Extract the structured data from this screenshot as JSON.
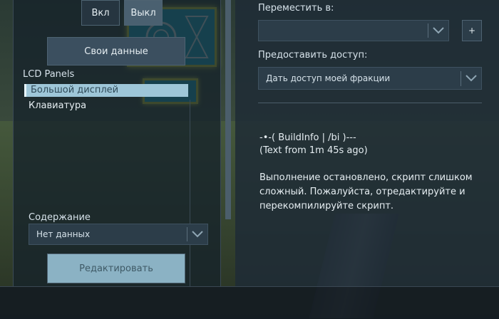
{
  "toggle": {
    "on_label": "Вкл",
    "off_label": "Выкл"
  },
  "custom_data_label": "Свои данные",
  "lcd": {
    "header": "LCD Panels",
    "items": [
      "Большой дисплей",
      "Клавиатура"
    ],
    "selected_index": 0
  },
  "content": {
    "label": "Содержание",
    "selected": "Нет данных"
  },
  "edit_label": "Редактировать",
  "move": {
    "label": "Переместить в:",
    "selected": "",
    "plus_label": "+"
  },
  "access": {
    "label": "Предоставить доступ:",
    "selected": "Дать доступ моей фракции"
  },
  "buildinfo": {
    "line1": "-•-( BuildInfo | /bi )---",
    "line2": "(Text from 1m 45s ago)",
    "message": "Выполнение остановлено, скрипт слишком сложный. Пожалуйста, отредактируйте и перекомпилируйте скрипт."
  },
  "icons": {
    "dropdown": "chevron-down-icon"
  },
  "colors": {
    "accent": "#9ec6d8",
    "panel": "#1aa7c7"
  }
}
